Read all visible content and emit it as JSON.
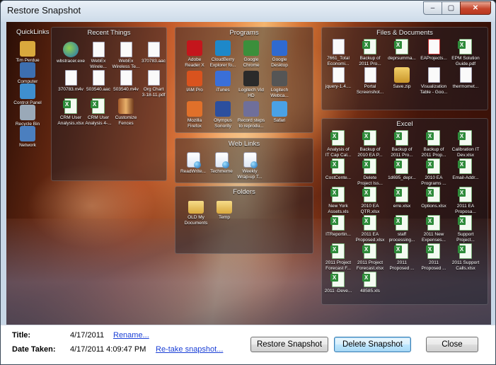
{
  "window": {
    "title": "Restore Snapshot",
    "min": "–",
    "max": "▢",
    "close": "✕"
  },
  "groups": {
    "quicklinks": {
      "title": "QuickLinks",
      "items": [
        {
          "label": "Tim Perdue",
          "icon": "user-folder-icon"
        },
        {
          "label": "Computer",
          "icon": "computer-icon"
        },
        {
          "label": "Control Panel",
          "icon": "control-panel-icon"
        },
        {
          "label": "Recycle Bin",
          "icon": "recycle-bin-icon"
        },
        {
          "label": "Network",
          "icon": "network-icon"
        }
      ]
    },
    "recent": {
      "title": "Recent Things",
      "items": [
        {
          "label": "wbstracer.exe",
          "l2": ""
        },
        {
          "label": "WebEx",
          "l2": "Wirele..."
        },
        {
          "label": "WebEx",
          "l2": "Wireless Te..."
        },
        {
          "label": "370783.aac",
          "l2": ""
        },
        {
          "label": "370783.m4v",
          "l2": ""
        },
        {
          "label": "503540.aac",
          "l2": ""
        },
        {
          "label": "503540.m4v",
          "l2": ""
        },
        {
          "label": "Org Chart",
          "l2": "3-18-11.pdf"
        },
        {
          "label": "CRM User",
          "l2": "Analysis.xlsx"
        },
        {
          "label": "CRM User",
          "l2": "Analysis 4-..."
        },
        {
          "label": "Customize",
          "l2": "Fences"
        }
      ]
    },
    "programs": {
      "title": "Programs",
      "items": [
        {
          "label": "Adobe",
          "l2": "Reader X",
          "color": "#c4161c"
        },
        {
          "label": "CloudBerry",
          "l2": "Explorer fo...",
          "color": "#1e88c9"
        },
        {
          "label": "Google",
          "l2": "Chrome",
          "color": "#3b8f3b"
        },
        {
          "label": "Google",
          "l2": "Desktop",
          "color": "#2f6ad0"
        },
        {
          "label": "IAM Pro",
          "l2": "",
          "color": "#d9531e"
        },
        {
          "label": "iTunes",
          "l2": "",
          "color": "#3a6fd8"
        },
        {
          "label": "Logitech Vid",
          "l2": "HD",
          "color": "#2a2a2a"
        },
        {
          "label": "Logitech",
          "l2": "Webca...",
          "color": "#555"
        },
        {
          "label": "Mozilla",
          "l2": "Firefox",
          "color": "#e0702a"
        },
        {
          "label": "Olympus",
          "l2": "Sonority",
          "color": "#2c4f9e"
        },
        {
          "label": "Record steps",
          "l2": "to reprodu...",
          "color": "#6f6f9a"
        },
        {
          "label": "Safari",
          "l2": "",
          "color": "#4aa1e6"
        }
      ]
    },
    "weblinks": {
      "title": "Web Links",
      "items": [
        {
          "label": "ReadWrite...",
          "l2": ""
        },
        {
          "label": "Techmeme",
          "l2": ""
        },
        {
          "label": "Weekly",
          "l2": "Wrap-up T..."
        }
      ]
    },
    "folders": {
      "title": "Folders",
      "items": [
        {
          "label": "OLD My",
          "l2": "Documents"
        },
        {
          "label": "Temp",
          "l2": ""
        }
      ]
    },
    "files": {
      "title": "Files & Documents",
      "items": [
        {
          "label": "7661_Total",
          "l2": "Economi...",
          "kind": "doc"
        },
        {
          "label": "Backup of",
          "l2": "2011 Pro...",
          "kind": "xls"
        },
        {
          "label": "deprsumma...",
          "l2": "",
          "kind": "xls"
        },
        {
          "label": "EAProjects...",
          "l2": "",
          "kind": "pdf"
        },
        {
          "label": "EPM Solution",
          "l2": "Guide.pdf",
          "kind": "xls"
        },
        {
          "label": "jquery-1.4....",
          "l2": "",
          "kind": "doc"
        },
        {
          "label": "Portal",
          "l2": "Screenshot...",
          "kind": "doc"
        },
        {
          "label": "Save.zip",
          "l2": "",
          "kind": "zip"
        },
        {
          "label": "Visualization",
          "l2": "Table - Goo...",
          "kind": "doc"
        },
        {
          "label": "thermomet...",
          "l2": "",
          "kind": "doc"
        }
      ]
    },
    "excel": {
      "title": "Excel",
      "items": [
        {
          "label": "Analysis of",
          "l2": "IT Cap Cal..."
        },
        {
          "label": "Backup of",
          "l2": "2010 EA P..."
        },
        {
          "label": "Backup of",
          "l2": "2011 Pro..."
        },
        {
          "label": "Backup of",
          "l2": "2011 Prop..."
        },
        {
          "label": "Calibration IT",
          "l2": "Dev.xlsx"
        },
        {
          "label": "CostCente...",
          "l2": ""
        },
        {
          "label": "Delete",
          "l2": "Project Iss..."
        },
        {
          "label": "1d695_depr...",
          "l2": ""
        },
        {
          "label": "2010 EA",
          "l2": "Programs ..."
        },
        {
          "label": "Email-Addr...",
          "l2": ""
        },
        {
          "label": "New York",
          "l2": "Assets.xls"
        },
        {
          "label": "2010 EA",
          "l2": "QTR.xlsx"
        },
        {
          "label": "erre.xlsx",
          "l2": ""
        },
        {
          "label": "Options.xlsx",
          "l2": ""
        },
        {
          "label": "2011 EA",
          "l2": "Proposa..."
        },
        {
          "label": "ITReportin...",
          "l2": ""
        },
        {
          "label": "2011 EA",
          "l2": "Proposed.xlsx"
        },
        {
          "label": "staff",
          "l2": "processing..."
        },
        {
          "label": "2011 New",
          "l2": "Expenses..."
        },
        {
          "label": "Support",
          "l2": "Project..."
        },
        {
          "label": "2011 Project",
          "l2": "Forecast F..."
        },
        {
          "label": "2011 Project",
          "l2": "Forecast.xlsx"
        },
        {
          "label": "2011",
          "l2": "Proposed ..."
        },
        {
          "label": "2011",
          "l2": "Proposed ..."
        },
        {
          "label": "2011 Support",
          "l2": "Calls.xlsx"
        },
        {
          "label": "2011 -Deve...",
          "l2": ""
        },
        {
          "label": "48585.xls",
          "l2": ""
        }
      ]
    }
  },
  "details": {
    "title_label": "Title:",
    "title_value": "4/17/2011",
    "rename_link": "Rename...",
    "date_label": "Date Taken:",
    "date_value": "4/17/2011 4:09:47 PM",
    "retake_link": "Re-take snapshot..."
  },
  "buttons": {
    "restore": "Restore Snapshot",
    "delete": "Delete Snapshot",
    "close": "Close"
  }
}
